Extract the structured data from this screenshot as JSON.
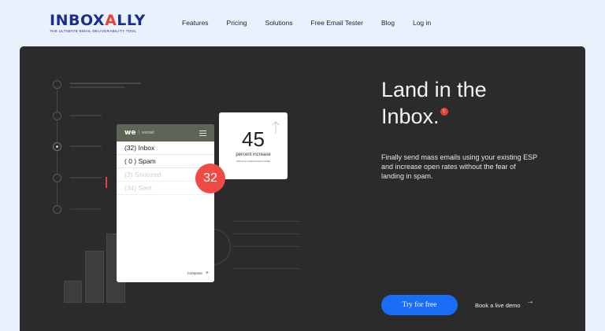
{
  "brand": {
    "name_prefix": "INBOX",
    "name_accent": "A",
    "name_suffix": "LLY",
    "tagline": "THE ULTIMATE EMAIL DELIVERABILITY TOOL"
  },
  "nav": {
    "items": [
      {
        "label": "Features"
      },
      {
        "label": "Pricing"
      },
      {
        "label": "Solutions"
      },
      {
        "label": "Free Email Tester"
      },
      {
        "label": "Blog"
      },
      {
        "label": "Log in"
      }
    ]
  },
  "mail_app": {
    "logo": "we",
    "brand": "wemail",
    "folders": [
      {
        "label": "(32) Inbox"
      },
      {
        "label": "( 0 ) Spam"
      },
      {
        "label": "(3) Snoozed"
      },
      {
        "label": "(34) Sent"
      }
    ],
    "compose_label": "Compose",
    "compose_plus": "+",
    "spam_badge": "32"
  },
  "stat": {
    "value": "45",
    "label": "percent increase",
    "footnote": "(100 more emails inboxed monthly)"
  },
  "hero": {
    "headline_line1": "Land in the",
    "headline_line2": "Inbox.",
    "headline_badge": "1",
    "subcopy_a": "Finally send mass emails using your existing ESP and ",
    "subcopy_b": "increase open rates",
    "subcopy_c": " without the fear of landing in spam.",
    "cta_label": "Try for free",
    "demo_label": "Book a live demo",
    "demo_arrow": "→"
  },
  "colors": {
    "brand_navy": "#1d2f8c",
    "accent_red": "#e8413a",
    "cta_blue": "#1a6df5",
    "hero_bg": "#2b2b2b",
    "page_bg": "#e8f1fc"
  }
}
